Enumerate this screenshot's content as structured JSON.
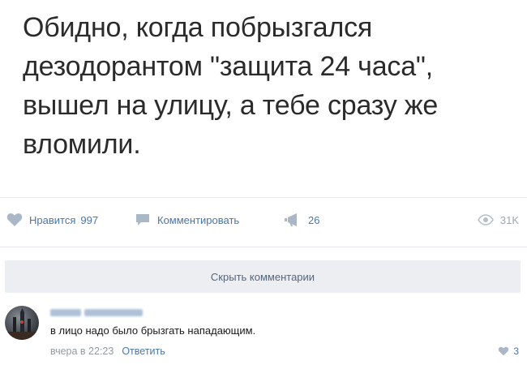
{
  "post": {
    "lines": [
      "Обидно, когда побрызгался",
      "дезодорантом \"защита 24 часа\",",
      "вышел на улицу, а тебе сразу же",
      "вломили."
    ]
  },
  "actions": {
    "like_label": "Нравится",
    "like_count": "997",
    "comment_label": "Комментировать",
    "share_count": "26",
    "views": "31K"
  },
  "comments": {
    "hide_label": "Скрыть комментарии",
    "items": [
      {
        "text": "в лицо надо было брызгать нападающим.",
        "time": "вчера в 22:23",
        "reply_label": "Ответить",
        "likes": "3"
      }
    ]
  },
  "colors": {
    "link": "#4a76a8",
    "muted": "#939aa3",
    "button_bg": "#eceef1"
  },
  "icons": [
    "heart-icon",
    "comment-icon",
    "share-icon",
    "eye-icon"
  ]
}
